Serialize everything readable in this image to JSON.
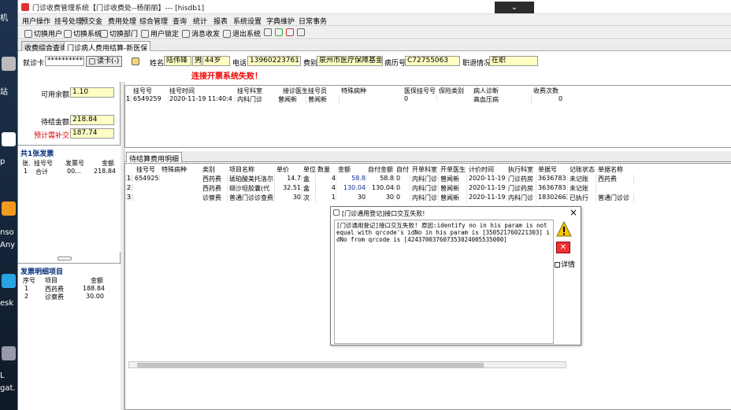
{
  "desktop": {
    "labels": [
      "机",
      "站",
      "p",
      "nso",
      "Any",
      "esk",
      "L",
      "gat."
    ]
  },
  "window": {
    "title": "门诊收费管理系统【门诊收费处--杨丽丽】--- [hisdb1]",
    "title_button": "⌄"
  },
  "menu": [
    "用户操作",
    "挂号处理",
    "预交金",
    "费用处理",
    "综合管理",
    "查询",
    "统计",
    "报表",
    "系统设置",
    "字典维护",
    "日常事务"
  ],
  "toolbar": [
    "切换用户",
    "切换系统",
    "切换部门",
    "用户锁定",
    "消息收发",
    "退出系统"
  ],
  "tabs": [
    {
      "label": "收费综合查询",
      "active": false
    },
    {
      "label": "门诊病人费用结算-新医保",
      "active": true
    }
  ],
  "patient": {
    "card_label": "就诊卡",
    "card_value": "************",
    "read_card_button": "读卡(-)",
    "name_label": "姓名",
    "name_value": "陆伟锋",
    "gender": "男",
    "age": "44岁",
    "phone_label": "电话",
    "phone_value": "13960223761",
    "fee_type_label": "费别",
    "fee_type_value": "泉州市医疗保障基金",
    "record_label": "病历号",
    "record_value": "C72755063",
    "job_label": "职退情况",
    "job_value": "在职",
    "message": "连接开票系统失败！"
  },
  "left": {
    "available_label": "可用余额",
    "available_value": "1.10",
    "pending_label": "待结金额",
    "pending_value": "218.84",
    "estimated_label": "预计需补交",
    "estimated_value": "187.74",
    "invoice_header": "共1张发票",
    "invoice_columns": [
      "张.",
      "挂号号",
      "发票号",
      "金额"
    ],
    "invoice_rows": [
      {
        "no": "1",
        "reg": "合计",
        "inv": "00...",
        "amount": "218.84"
      }
    ],
    "detail_header": "发票明细项目",
    "detail_columns": [
      "序号",
      "项目",
      "金额"
    ],
    "detail_rows": [
      {
        "no": "1",
        "item": "西药费",
        "amount": "188.84"
      },
      {
        "no": "2",
        "item": "诊察费",
        "amount": "30.00"
      }
    ]
  },
  "reg_grid": {
    "columns": [
      "挂号号",
      "挂号时间",
      "挂号科室",
      "接诊医生",
      "挂号员",
      "特殊病种",
      "医保挂号号",
      "保险类别",
      "病人诊断",
      "收费次数"
    ],
    "rows": [
      [
        "6549259",
        "2020-11-19 11:40:4",
        "内科门诊",
        "曾闻新",
        "曾闻新",
        "",
        "0",
        "",
        "高血压病",
        "0"
      ]
    ]
  },
  "fee_grid": {
    "tab_label": "待结算费用明细",
    "columns": [
      "挂号号",
      "特殊病种",
      "类别",
      "项目名称",
      "单价",
      "单位",
      "数量",
      "金额",
      "自付金额",
      "自付",
      "开单科室",
      "开单医生",
      "计价时间",
      "执行科室",
      "单据号",
      "记账状态",
      "单据名称"
    ],
    "rows": [
      [
        "6549259",
        "",
        "西药费",
        "琥珀酸美托洛尔",
        "14.7",
        "盒",
        "4",
        "58.8",
        "58.8",
        "0",
        "内科门诊",
        "曾闻新",
        "2020-11-19",
        "门诊药房",
        "3636783",
        "未记账",
        "西药费"
      ],
      [
        "",
        "",
        "西药费",
        "缬沙坦胶囊(代",
        "32.51",
        "盒",
        "4",
        "130.04",
        "130.04",
        "0",
        "内科门诊",
        "曾闻新",
        "2020-11-19",
        "门诊药房",
        "3636783",
        "未记账",
        ""
      ],
      [
        "",
        "",
        "诊察费",
        "普通门诊诊查费",
        "30",
        "次",
        "1",
        "30",
        "30",
        "0",
        "内科门诊",
        "曾闻新",
        "2020-11-19",
        "内科门诊",
        "18302662",
        "已执行",
        "普通门诊诊"
      ]
    ]
  },
  "dialog": {
    "title": "[门诊通用登记]接口交互失败!",
    "close": "×",
    "message": "[门诊通用登记]接口交互失败! 原因:identify no in his param is not equal with qrcode's idNo in his param is [350521760221303] idNo from qrcode is [424370037607353024005535000]",
    "details_label": "详情",
    "warning_icon_color": "#f5c400",
    "error_button_color": "#e33333"
  }
}
